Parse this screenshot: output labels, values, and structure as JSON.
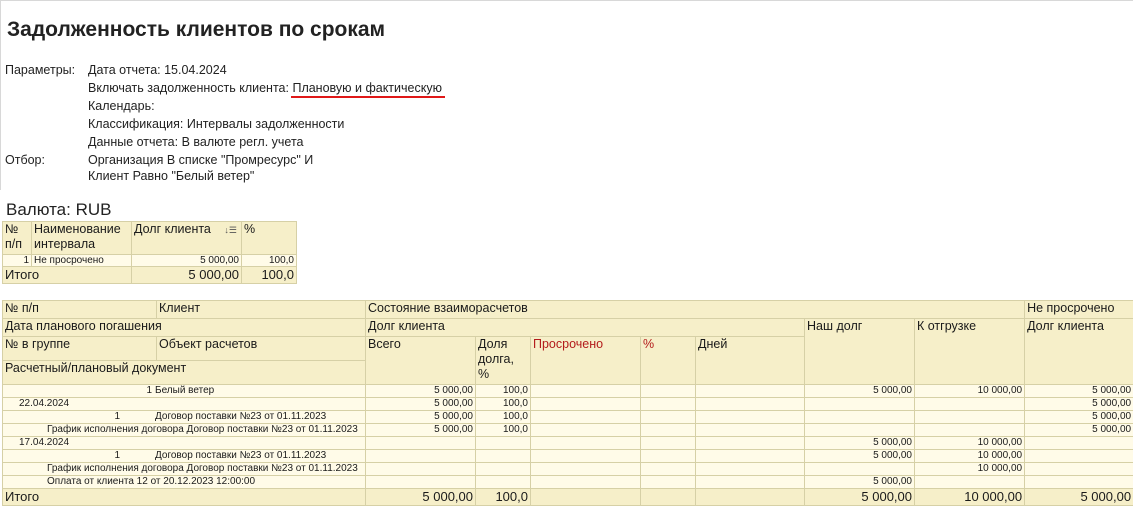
{
  "report": {
    "title": "Задолженность клиентов по срокам",
    "params_label": "Параметры:",
    "params": [
      {
        "text": "Дата отчета: 15.04.2024"
      },
      {
        "prefix": "Включать задолженность клиента: ",
        "value": "Плановую и фактическую"
      },
      {
        "text": "Календарь:"
      },
      {
        "text": "Классификация: Интервалы задолженности"
      },
      {
        "text": "Данные отчета: В валюте регл. учета"
      }
    ],
    "filter_label": "Отбор:",
    "filter": [
      "Организация В списке \"Промресурс\" И",
      "Клиент Равно \"Белый ветер\""
    ],
    "currency": "Валюта: RUB",
    "accent_underline_color": "#e01818"
  },
  "summary": {
    "headers": {
      "num": "№ п/п",
      "interval": "Наименование интервала",
      "debt": "Долг клиента",
      "pct": "%"
    },
    "sort_icon": "sort-desc-icon",
    "rows": [
      {
        "num": "1",
        "interval": "Не просрочено",
        "debt": "5 000,00",
        "pct": "100,0"
      }
    ],
    "total": {
      "label": "Итого",
      "debt": "5 000,00",
      "pct": "100,0"
    }
  },
  "detail": {
    "headers": {
      "num": "№ п/п",
      "client": "Клиент",
      "state": "Состояние взаиморасчетов",
      "not_overdue": "Не просрочено",
      "due_date": "Дата планового погашения",
      "client_debt": "Долг клиента",
      "our_debt": "Наш долг",
      "to_ship": "К отгрузке",
      "client_debt2": "Долг клиента",
      "group_num": "№ в группе",
      "object": "Объект расчетов",
      "total": "Всего",
      "share": "Доля долга, %",
      "overdue": "Просрочено",
      "pct": "%",
      "days": "Дней",
      "doc": "Расчетный/плановый документ"
    },
    "rows": [
      {
        "label_num": "1",
        "label_text": "Белый ветер",
        "indent": "none",
        "total": "5 000,00",
        "share": "100,0",
        "overdue": "",
        "pct": "",
        "days": "",
        "our_debt": "5 000,00",
        "to_ship": "10 000,00",
        "client_debt": "5 000,00"
      },
      {
        "label_num": "",
        "label_text": "22.04.2024",
        "indent": "date",
        "total": "5 000,00",
        "share": "100,0",
        "overdue": "",
        "pct": "",
        "days": "",
        "our_debt": "",
        "to_ship": "",
        "client_debt": "5 000,00"
      },
      {
        "label_num": "1",
        "label_text": "Договор поставки №23 от 01.11.2023",
        "indent": "contract",
        "total": "5 000,00",
        "share": "100,0",
        "overdue": "",
        "pct": "",
        "days": "",
        "our_debt": "",
        "to_ship": "",
        "client_debt": "5 000,00"
      },
      {
        "label_num": "",
        "label_text": "График исполнения договора Договор поставки №23 от 01.11.2023",
        "indent": "doc",
        "total": "5 000,00",
        "share": "100,0",
        "overdue": "",
        "pct": "",
        "days": "",
        "our_debt": "",
        "to_ship": "",
        "client_debt": "5 000,00"
      },
      {
        "label_num": "",
        "label_text": "17.04.2024",
        "indent": "date",
        "total": "",
        "share": "",
        "overdue": "",
        "pct": "",
        "days": "",
        "our_debt": "5 000,00",
        "to_ship": "10 000,00",
        "client_debt": ""
      },
      {
        "label_num": "1",
        "label_text": "Договор поставки №23 от 01.11.2023",
        "indent": "contract",
        "total": "",
        "share": "",
        "overdue": "",
        "pct": "",
        "days": "",
        "our_debt": "5 000,00",
        "to_ship": "10 000,00",
        "client_debt": ""
      },
      {
        "label_num": "",
        "label_text": "График исполнения договора Договор поставки №23 от 01.11.2023",
        "indent": "doc",
        "total": "",
        "share": "",
        "overdue": "",
        "pct": "",
        "days": "",
        "our_debt": "",
        "to_ship": "10 000,00",
        "client_debt": ""
      },
      {
        "label_num": "",
        "label_text": "Оплата от клиента 12 от 20.12.2023 12:00:00",
        "indent": "doc",
        "total": "",
        "share": "",
        "overdue": "",
        "pct": "",
        "days": "",
        "our_debt": "5 000,00",
        "to_ship": "",
        "client_debt": ""
      }
    ],
    "total": {
      "label": "Итого",
      "total": "5 000,00",
      "share": "100,0",
      "our_debt": "5 000,00",
      "to_ship": "10 000,00",
      "client_debt": "5 000,00"
    }
  }
}
